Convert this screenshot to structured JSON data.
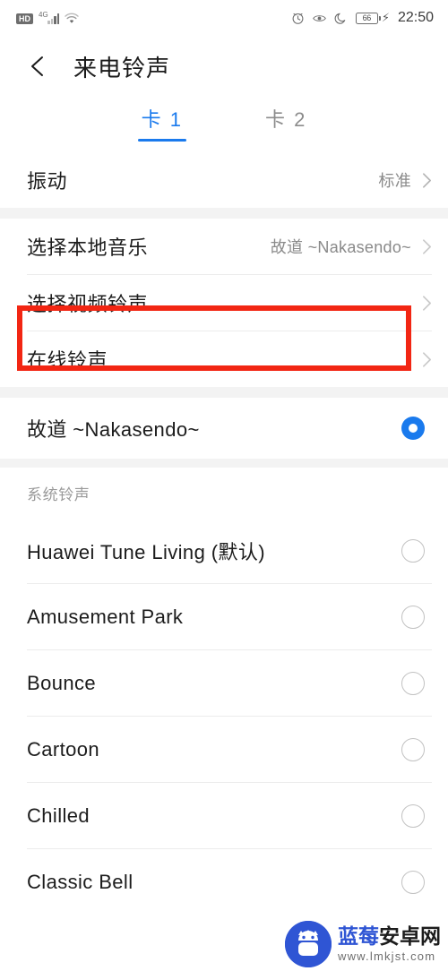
{
  "statusbar": {
    "hd_label": "HD",
    "network_label": "4G",
    "signal_icon": "signal-bars-icon",
    "wifi_icon": "wifi-icon",
    "alarm_icon": "alarm-icon",
    "eye_icon": "eye-comfort-icon",
    "dnd_icon": "moon-do-not-disturb-icon",
    "battery_level": "66",
    "charging_icon": "charging-bolt-icon",
    "time": "22:50"
  },
  "titlebar": {
    "back_icon": "back-arrow-icon",
    "title": "来电铃声"
  },
  "tabs": [
    {
      "label": "卡 1",
      "active": true
    },
    {
      "label": "卡 2",
      "active": false
    }
  ],
  "settings": {
    "vibration": {
      "label": "振动",
      "value": "标准",
      "chevron_icon": "chevron-right-icon"
    },
    "local_music": {
      "label": "选择本地音乐",
      "value": "故道 ~Nakasendo~",
      "chevron_icon": "chevron-right-icon"
    },
    "video_ringtone": {
      "label": "选择视频铃声",
      "value": "",
      "chevron_icon": "chevron-right-icon",
      "highlighted": true
    },
    "online_ringtone": {
      "label": "在线铃声",
      "value": "",
      "chevron_icon": "chevron-right-icon"
    }
  },
  "current_selection": {
    "label": "故道 ~Nakasendo~",
    "selected": true
  },
  "system_section": {
    "header": "系统铃声",
    "items": [
      {
        "label": "Huawei Tune Living (默认)",
        "selected": false
      },
      {
        "label": "Amusement Park",
        "selected": false
      },
      {
        "label": "Bounce",
        "selected": false
      },
      {
        "label": "Cartoon",
        "selected": false
      },
      {
        "label": "Chilled",
        "selected": false
      },
      {
        "label": "Classic Bell",
        "selected": false
      }
    ]
  },
  "watermark": {
    "name_part1": "蓝莓",
    "name_part2": "安卓网",
    "url": "www.lmkjst.com",
    "logo_icon": "blueberry-android-mascot-icon"
  },
  "colors": {
    "accent": "#1a7aed",
    "highlight": "#f22613",
    "watermark_blue": "#2f55d4",
    "divider": "#ececec",
    "section_gap": "#f3f3f3"
  }
}
